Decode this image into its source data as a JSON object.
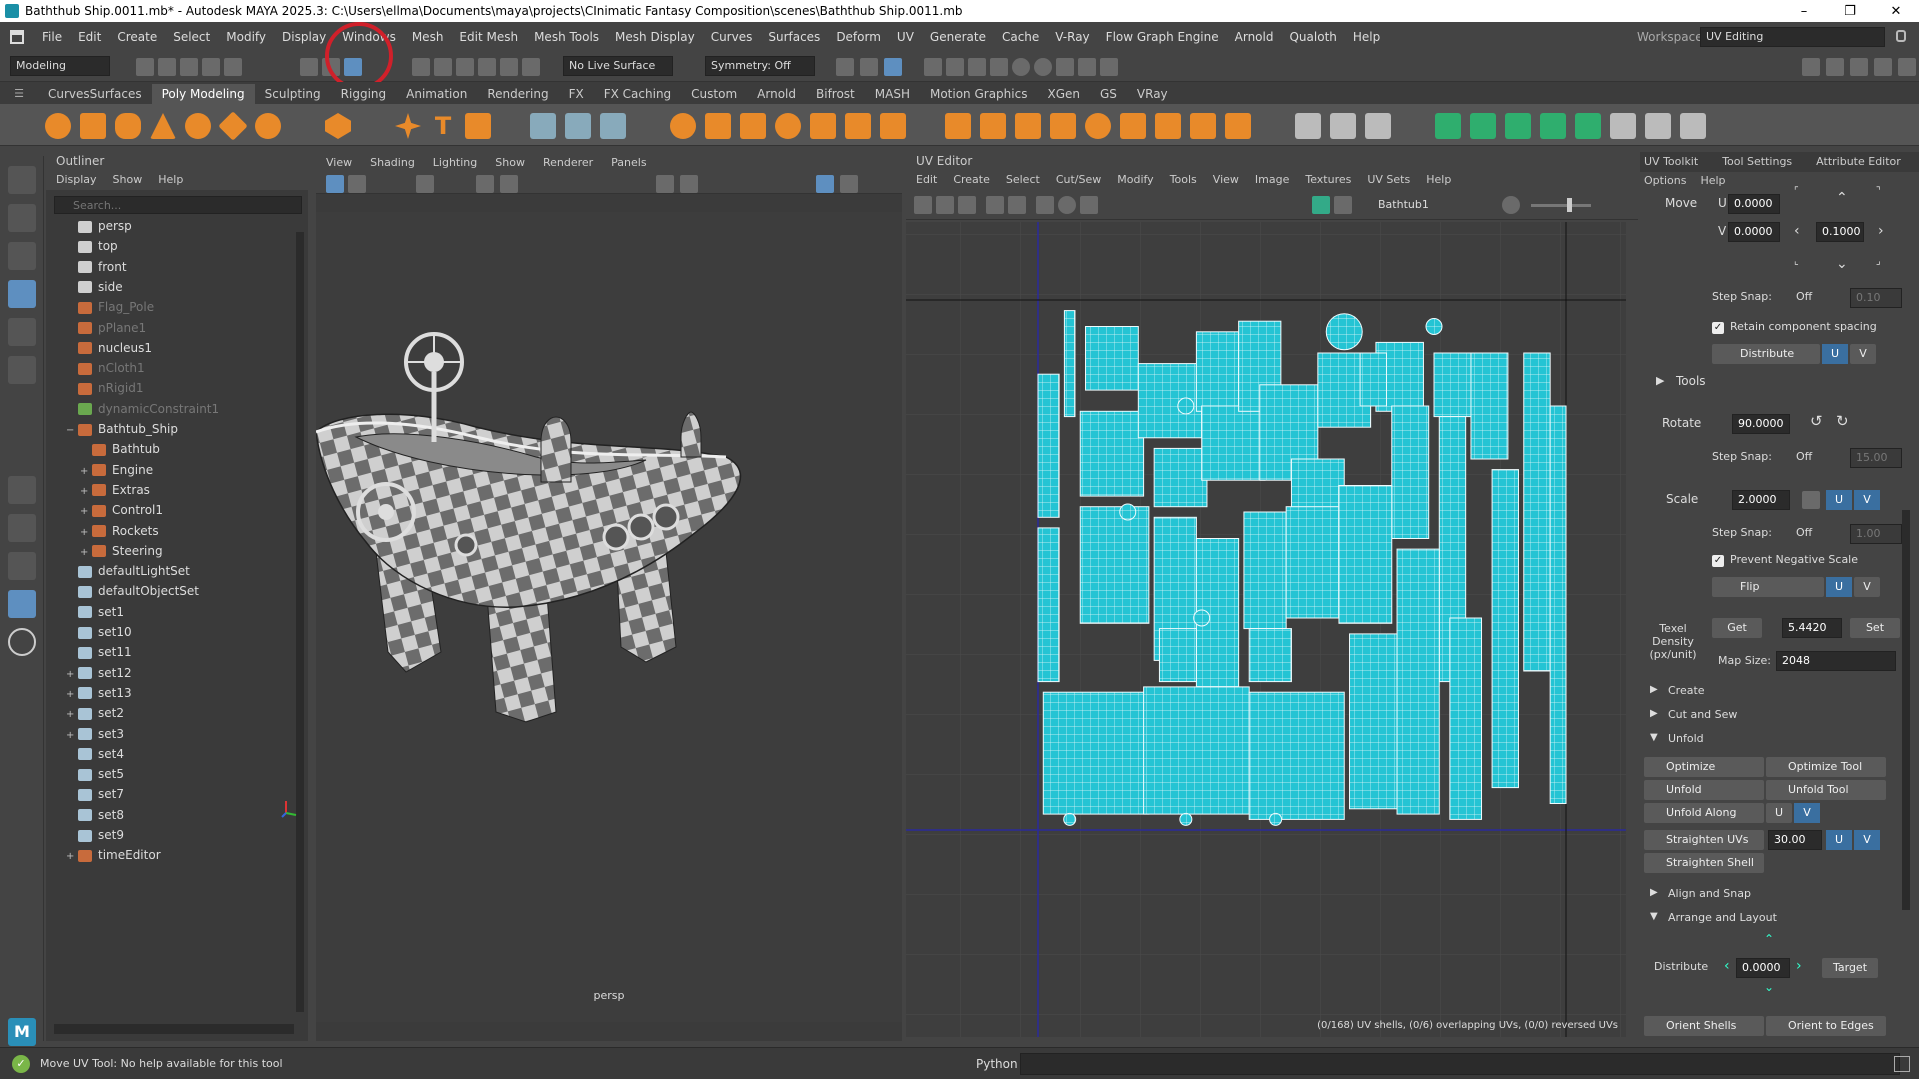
{
  "title": "Baththub Ship.0011.mb* - Autodesk MAYA 2025.3: C:\\Users\\ellma\\Documents\\maya\\projects\\CInimatic Fantasy Composition\\scenes\\Baththub Ship.0011.mb",
  "window_controls": {
    "min": "–",
    "max": "❐",
    "close": "✕"
  },
  "menus": [
    "File",
    "Edit",
    "Create",
    "Select",
    "Modify",
    "Display",
    "Windows",
    "Mesh",
    "Edit Mesh",
    "Mesh Tools",
    "Mesh Display",
    "Curves",
    "Surfaces",
    "Deform",
    "UV",
    "Generate",
    "Cache",
    "V-Ray",
    "Flow Graph Engine",
    "Arnold",
    "Qualoth",
    "Help"
  ],
  "workspace": {
    "label": "Workspace:",
    "value": "UV Editing"
  },
  "statusline": {
    "mode": "Modeling",
    "live_surface": "No Live Surface",
    "symmetry": "Symmetry: Off"
  },
  "shelf_tabs": [
    "CurvesSurfaces",
    "Poly Modeling",
    "Sculpting",
    "Rigging",
    "Animation",
    "Rendering",
    "FX",
    "FX Caching",
    "Custom",
    "Arnold",
    "Bifrost",
    "MASH",
    "Motion Graphics",
    "XGen",
    "GS",
    "VRay"
  ],
  "shelf_active": "Poly Modeling",
  "outliner": {
    "title": "Outliner",
    "menu": [
      "Display",
      "Show",
      "Help"
    ],
    "search_placeholder": "Search...",
    "items": [
      {
        "label": "persp",
        "indent": 0,
        "dim": false,
        "expand": ""
      },
      {
        "label": "top",
        "indent": 0,
        "dim": false,
        "expand": ""
      },
      {
        "label": "front",
        "indent": 0,
        "dim": false,
        "expand": ""
      },
      {
        "label": "side",
        "indent": 0,
        "dim": false,
        "expand": ""
      },
      {
        "label": "Flag_Pole",
        "indent": 0,
        "dim": true,
        "expand": ""
      },
      {
        "label": "pPlane1",
        "indent": 0,
        "dim": true,
        "expand": ""
      },
      {
        "label": "nucleus1",
        "indent": 0,
        "dim": false,
        "expand": ""
      },
      {
        "label": "nCloth1",
        "indent": 0,
        "dim": true,
        "expand": ""
      },
      {
        "label": "nRigid1",
        "indent": 0,
        "dim": true,
        "expand": ""
      },
      {
        "label": "dynamicConstraint1",
        "indent": 0,
        "dim": true,
        "expand": ""
      },
      {
        "label": "Bathtub_Ship",
        "indent": 0,
        "dim": false,
        "expand": "−"
      },
      {
        "label": "Bathtub",
        "indent": 1,
        "dim": false,
        "expand": ""
      },
      {
        "label": "Engine",
        "indent": 1,
        "dim": false,
        "expand": "+"
      },
      {
        "label": "Extras",
        "indent": 1,
        "dim": false,
        "expand": "+"
      },
      {
        "label": "Control1",
        "indent": 1,
        "dim": false,
        "expand": "+"
      },
      {
        "label": "Rockets",
        "indent": 1,
        "dim": false,
        "expand": "+"
      },
      {
        "label": "Steering",
        "indent": 1,
        "dim": false,
        "expand": "+"
      },
      {
        "label": "defaultLightSet",
        "indent": 0,
        "dim": false,
        "expand": ""
      },
      {
        "label": "defaultObjectSet",
        "indent": 0,
        "dim": false,
        "expand": ""
      },
      {
        "label": "set1",
        "indent": 0,
        "dim": false,
        "expand": ""
      },
      {
        "label": "set10",
        "indent": 0,
        "dim": false,
        "expand": ""
      },
      {
        "label": "set11",
        "indent": 0,
        "dim": false,
        "expand": ""
      },
      {
        "label": "set12",
        "indent": 0,
        "dim": false,
        "expand": "+"
      },
      {
        "label": "set13",
        "indent": 0,
        "dim": false,
        "expand": "+"
      },
      {
        "label": "set2",
        "indent": 0,
        "dim": false,
        "expand": "+"
      },
      {
        "label": "set3",
        "indent": 0,
        "dim": false,
        "expand": "+"
      },
      {
        "label": "set4",
        "indent": 0,
        "dim": false,
        "expand": ""
      },
      {
        "label": "set5",
        "indent": 0,
        "dim": false,
        "expand": ""
      },
      {
        "label": "set7",
        "indent": 0,
        "dim": false,
        "expand": ""
      },
      {
        "label": "set8",
        "indent": 0,
        "dim": false,
        "expand": ""
      },
      {
        "label": "set9",
        "indent": 0,
        "dim": false,
        "expand": ""
      },
      {
        "label": "timeEditor",
        "indent": 0,
        "dim": false,
        "expand": "+"
      }
    ]
  },
  "viewport": {
    "menu": [
      "View",
      "Shading",
      "Lighting",
      "Show",
      "Renderer",
      "Panels"
    ],
    "camera": "persp"
  },
  "uv_editor": {
    "title": "UV Editor",
    "menu": [
      "Edit",
      "Create",
      "Select",
      "Cut/Sew",
      "Modify",
      "Tools",
      "View",
      "Image",
      "Textures",
      "UV Sets",
      "Help"
    ],
    "texture": "Bathtub1",
    "status": "(0/168) UV shells, (0/6) overlapping UVs, (0/0) reversed UVs"
  },
  "uv_toolkit": {
    "tabs": [
      "UV Toolkit",
      "Tool Settings",
      "Attribute Editor"
    ],
    "menu": [
      "Options",
      "Help"
    ],
    "move_label": "Move",
    "u_label": "U",
    "v_label": "V",
    "move_u": "0.0000",
    "move_v": "0.0000",
    "move_step": "0.1000",
    "step_snap_label": "Step Snap:",
    "step_snap": "Off",
    "step_snap_val1": "0.10",
    "step_snap_val2": "15.00",
    "step_snap_val3": "1.00",
    "retain_spacing": "Retain component spacing",
    "distribute": "Distribute",
    "tools_label": "Tools",
    "rotate_label": "Rotate",
    "rotate_val": "90.0000",
    "scale_label": "Scale",
    "scale_val": "2.0000",
    "prevent_neg": "Prevent Negative Scale",
    "flip": "Flip",
    "texel_label": "Texel Density (px/unit)",
    "get": "Get",
    "texel_val": "5.4420",
    "set": "Set",
    "map_size_label": "Map Size:",
    "map_size": "2048",
    "sections": [
      "Create",
      "Cut and Sew",
      "Unfold"
    ],
    "optimize": "Optimize",
    "optimize_tool": "Optimize Tool",
    "unfold": "Unfold",
    "unfold_tool": "Unfold Tool",
    "unfold_along": "Unfold Along",
    "straighten_uvs": "Straighten UVs",
    "straighten_val": "30.00",
    "straighten_shell": "Straighten Shell",
    "align_snap": "Align and Snap",
    "arrange": "Arrange and Layout",
    "distribute2": "Distribute",
    "distribute_val": "0.0000",
    "target": "Target",
    "orient_shells": "Orient Shells",
    "orient_edges": "Orient to Edges"
  },
  "help_line": "Move UV Tool: No help available for this tool",
  "python_label": "Python",
  "colors": {
    "accent": "#24c4d4",
    "highlight_circle": "#d0202a",
    "active_blue": "#3a6fa0"
  }
}
